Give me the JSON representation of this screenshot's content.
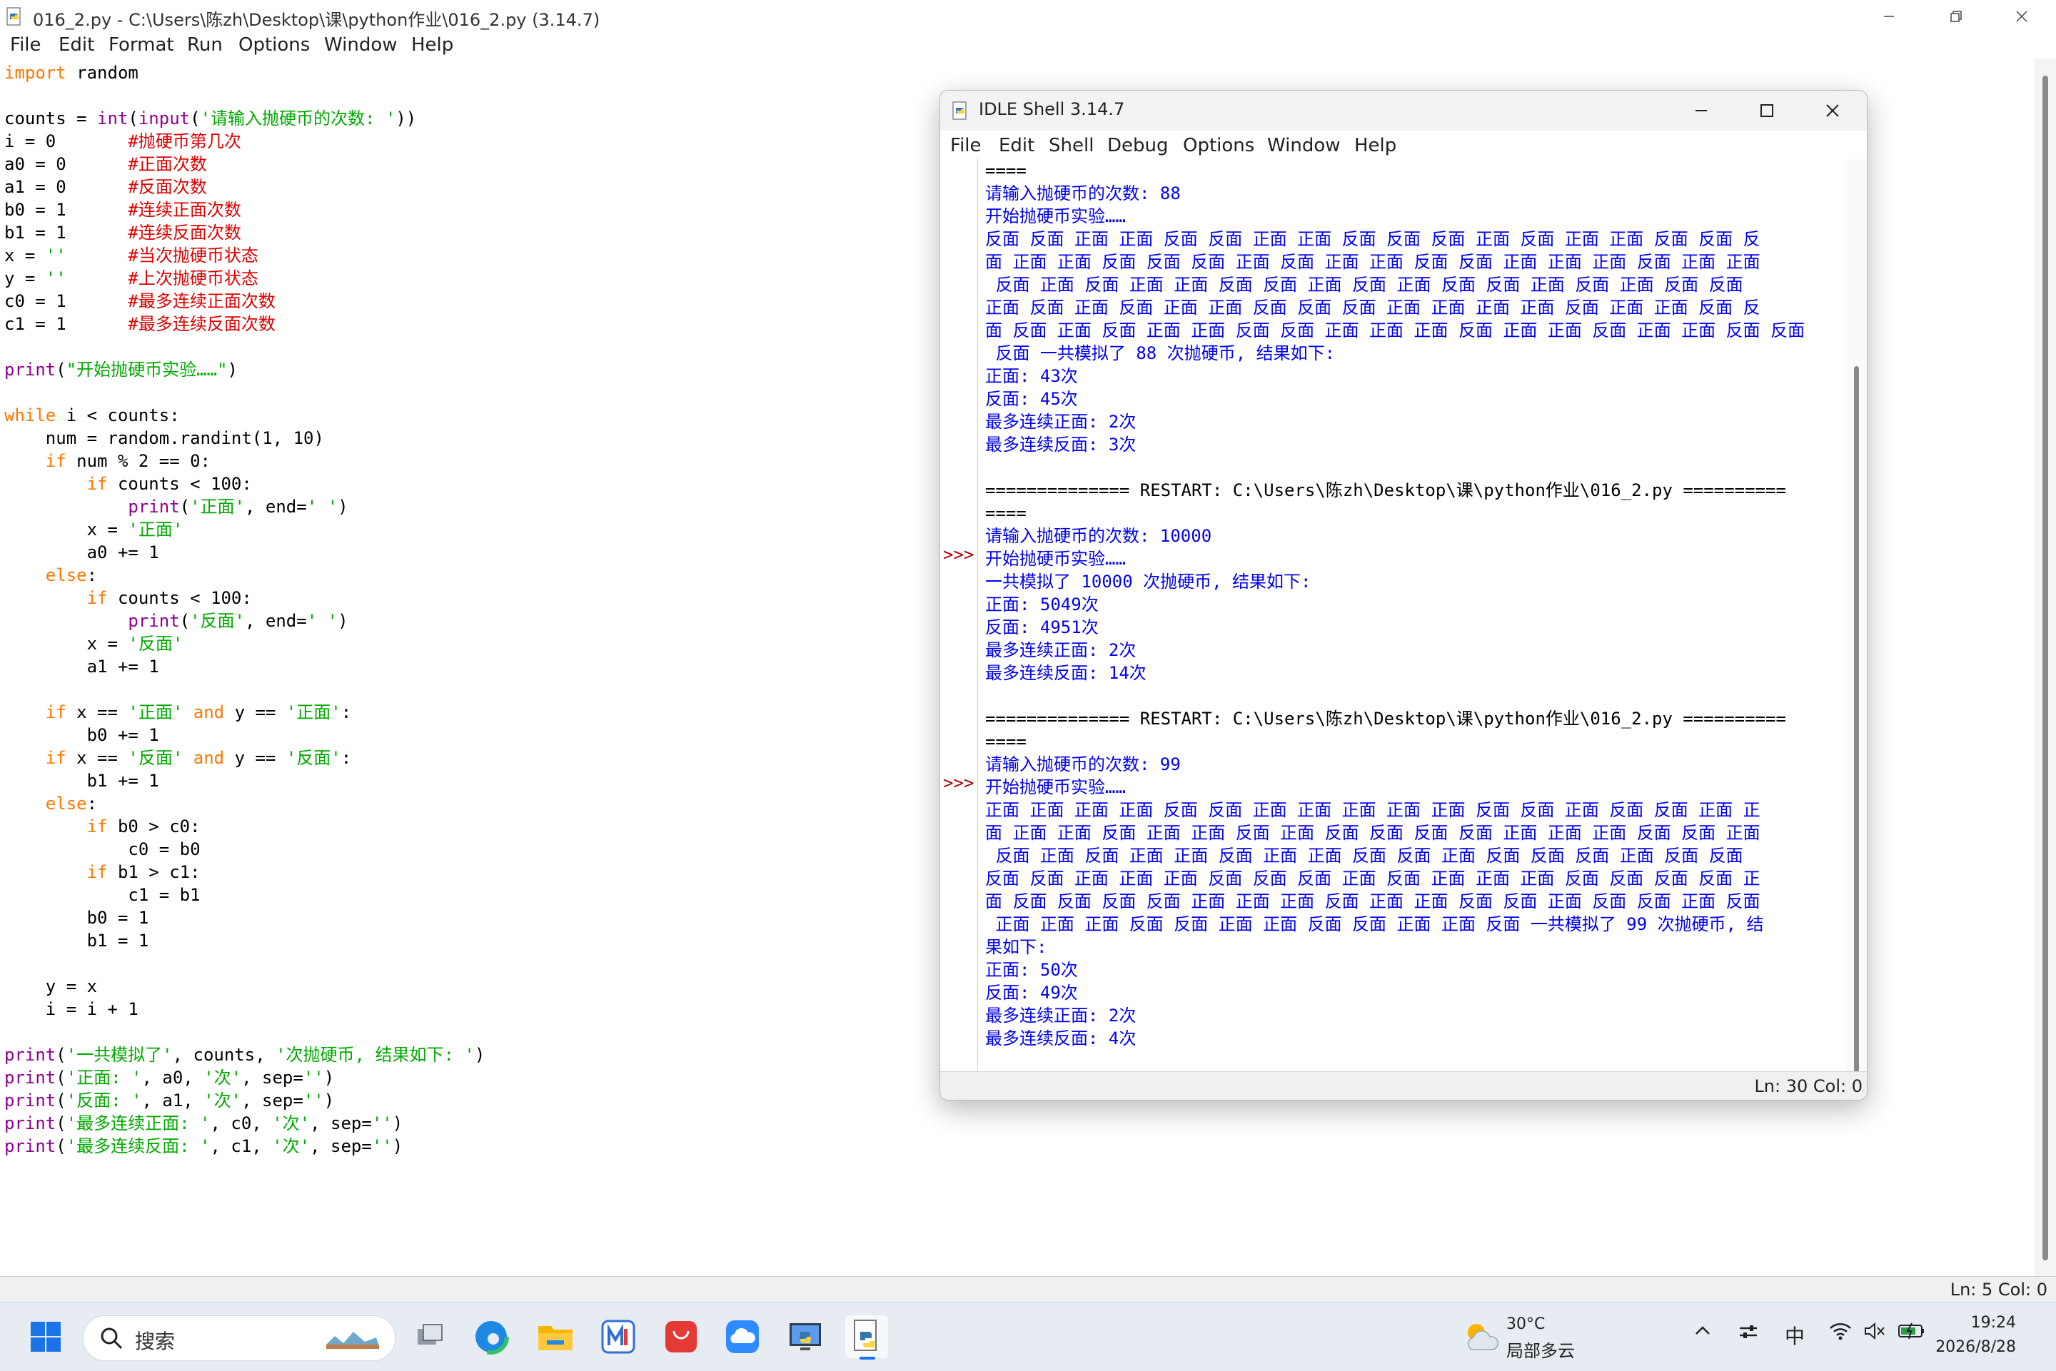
{
  "editor": {
    "title": "016_2.py - C:\\Users\\陈zh\\Desktop\\课\\python作业\\016_2.py (3.14.7)",
    "menu": [
      "File",
      "Edit",
      "Format",
      "Run",
      "Options",
      "Window",
      "Help"
    ],
    "status": "Ln: 5  Col: 0"
  },
  "shell": {
    "title": "IDLE Shell 3.14.7",
    "menu": [
      "File",
      "Edit",
      "Shell",
      "Debug",
      "Options",
      "Window",
      "Help"
    ],
    "prompt": ">>>",
    "lines": [
      "====",
      "请输入抛硬币的次数: 88",
      "开始抛硬币实验……",
      "反面 反面 正面 正面 反面 反面 正面 正面 反面 反面 反面 正面 反面 正面 正面 反面 反面 反",
      "面 正面 正面 反面 反面 反面 正面 反面 正面 正面 反面 反面 正面 正面 正面 反面 正面 正面",
      " 反面 正面 反面 正面 正面 反面 反面 正面 反面 正面 反面 反面 正面 反面 正面 反面 反面",
      "正面 反面 正面 反面 正面 正面 反面 反面 反面 正面 正面 正面 正面 反面 正面 正面 反面 反",
      "面 反面 正面 反面 正面 正面 反面 反面 正面 正面 正面 反面 正面 正面 反面 正面 正面 反面 反面",
      " 反面 一共模拟了 88 次抛硬币, 结果如下:",
      "正面: 43次",
      "反面: 45次",
      "最多连续正面: 2次",
      "最多连续反面: 3次",
      "",
      "============== RESTART: C:\\Users\\陈zh\\Desktop\\课\\python作业\\016_2.py ==========",
      "====",
      "请输入抛硬币的次数: 10000",
      "开始抛硬币实验……",
      "一共模拟了 10000 次抛硬币, 结果如下:",
      "正面: 5049次",
      "反面: 4951次",
      "最多连续正面: 2次",
      "最多连续反面: 14次",
      "",
      "============== RESTART: C:\\Users\\陈zh\\Desktop\\课\\python作业\\016_2.py ==========",
      "====",
      "请输入抛硬币的次数: 99",
      "开始抛硬币实验……",
      "正面 正面 正面 正面 反面 反面 正面 正面 正面 正面 正面 反面 反面 正面 反面 反面 正面 正",
      "面 正面 正面 反面 正面 正面 反面 正面 反面 反面 反面 反面 正面 正面 正面 反面 反面 正面",
      " 反面 正面 反面 正面 正面 反面 正面 正面 反面 反面 正面 反面 反面 反面 正面 反面 反面",
      "反面 反面 正面 正面 正面 反面 反面 反面 正面 反面 正面 正面 正面 反面 反面 反面 反面 正",
      "面 反面 反面 反面 反面 正面 正面 正面 反面 正面 正面 反面 反面 正面 反面 反面 正面 反面",
      " 正面 正面 正面 反面 反面 正面 正面 反面 反面 正面 正面 反面 一共模拟了 99 次抛硬币, 结",
      "果如下:",
      "正面: 50次",
      "反面: 49次",
      "最多连续正面: 2次",
      "最多连续反面: 4次"
    ],
    "status": "Ln: 30  Col: 0"
  },
  "taskbar": {
    "search_placeholder": "搜索",
    "weather_temp": "30°C",
    "weather_desc": "局部多云",
    "ime": "中",
    "time": "19:24",
    "date": "2026/8/28"
  }
}
